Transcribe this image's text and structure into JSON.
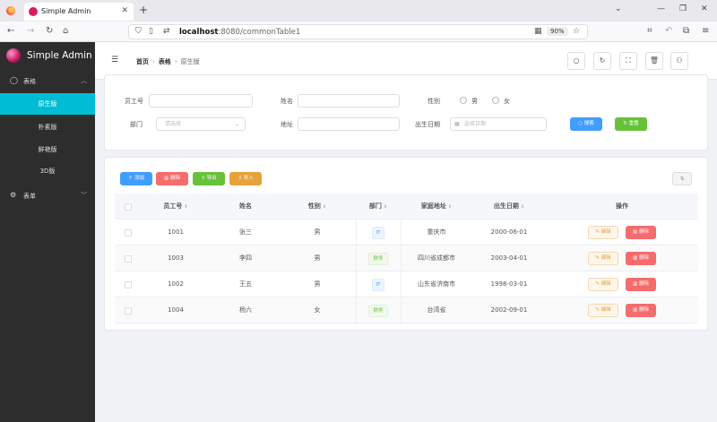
{
  "browser": {
    "tab_title": "Simple Admin",
    "url_host": "localhost",
    "url_path": ":8080/commonTable1",
    "zoom": "90%"
  },
  "sidebar": {
    "brand": "Simple Admin",
    "group_table": "表格",
    "items": [
      "原生版",
      "朴素版",
      "鲜艳版",
      "3D版"
    ],
    "active_index": 0,
    "group_form": "表单"
  },
  "header": {
    "breadcrumb": [
      "首页",
      "表格",
      "原生版"
    ]
  },
  "search": {
    "emp_no_label": "员工号",
    "name_label": "姓名",
    "gender_label": "性别",
    "gender_male": "男",
    "gender_female": "女",
    "dept_label": "部门",
    "dept_placeholder": "请选择",
    "address_label": "地址",
    "birth_label": "出生日期",
    "birth_placeholder": "选择日期",
    "search_btn": "搜索",
    "reset_btn": "重置"
  },
  "toolbar": {
    "add": "添加",
    "delete": "删除",
    "export": "导出",
    "import": "导入"
  },
  "table": {
    "headers": [
      "员工号",
      "姓名",
      "性别",
      "部门",
      "家庭地址",
      "出生日期",
      "操作"
    ],
    "edit_label": "编辑",
    "delete_label": "删除",
    "rows": [
      {
        "id": "1001",
        "name": "张三",
        "gender": "男",
        "dept": "IT",
        "address": "重庆市",
        "birth": "2000-06-01"
      },
      {
        "id": "1003",
        "name": "李四",
        "gender": "男",
        "dept": "财务",
        "address": "四川省成都市",
        "birth": "2003-04-01"
      },
      {
        "id": "1002",
        "name": "王五",
        "gender": "男",
        "dept": "IT",
        "address": "山东省济南市",
        "birth": "1998-03-01"
      },
      {
        "id": "1004",
        "name": "杨六",
        "gender": "女",
        "dept": "财务",
        "address": "台湾省",
        "birth": "2002-09-01"
      }
    ]
  },
  "colors": {
    "sidebar_bg": "#2d2d2d",
    "active_menu": "#00bcd4",
    "primary": "#409eff",
    "success": "#67c23a",
    "danger": "#f56c6c",
    "warning": "#e6a23c"
  }
}
